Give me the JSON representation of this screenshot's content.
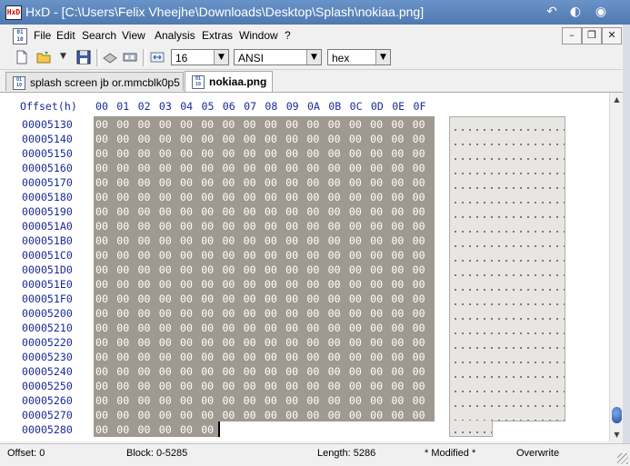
{
  "window": {
    "title": "HxD - [C:\\Users\\Felix Vheejhe\\Downloads\\Desktop\\Splash\\nokiaa.png]",
    "app_icon_text": "HxD"
  },
  "menu": [
    "File",
    "Edit",
    "Search",
    "View",
    "Analysis",
    "Extras",
    "Window",
    "?"
  ],
  "toolbar": {
    "bytes_per_row": "16",
    "charset": "ANSI",
    "offset_base": "hex"
  },
  "tabs": [
    {
      "label": "splash screen jb or.mmcblk0p5",
      "active": false
    },
    {
      "label": "nokiaa.png",
      "active": true
    }
  ],
  "hex_header": {
    "offset_label": "Offset(h)",
    "columns": [
      "00",
      "01",
      "02",
      "03",
      "04",
      "05",
      "06",
      "07",
      "08",
      "09",
      "0A",
      "0B",
      "0C",
      "0D",
      "0E",
      "0F"
    ]
  },
  "rows": [
    {
      "offset": "00005130",
      "bytes": "00 00 00 00 00 00 00 00 00 00 00 00 00 00 00 00"
    },
    {
      "offset": "00005140",
      "bytes": "00 00 00 00 00 00 00 00 00 00 00 00 00 00 00 00"
    },
    {
      "offset": "00005150",
      "bytes": "00 00 00 00 00 00 00 00 00 00 00 00 00 00 00 00"
    },
    {
      "offset": "00005160",
      "bytes": "00 00 00 00 00 00 00 00 00 00 00 00 00 00 00 00"
    },
    {
      "offset": "00005170",
      "bytes": "00 00 00 00 00 00 00 00 00 00 00 00 00 00 00 00"
    },
    {
      "offset": "00005180",
      "bytes": "00 00 00 00 00 00 00 00 00 00 00 00 00 00 00 00"
    },
    {
      "offset": "00005190",
      "bytes": "00 00 00 00 00 00 00 00 00 00 00 00 00 00 00 00"
    },
    {
      "offset": "000051A0",
      "bytes": "00 00 00 00 00 00 00 00 00 00 00 00 00 00 00 00"
    },
    {
      "offset": "000051B0",
      "bytes": "00 00 00 00 00 00 00 00 00 00 00 00 00 00 00 00"
    },
    {
      "offset": "000051C0",
      "bytes": "00 00 00 00 00 00 00 00 00 00 00 00 00 00 00 00"
    },
    {
      "offset": "000051D0",
      "bytes": "00 00 00 00 00 00 00 00 00 00 00 00 00 00 00 00"
    },
    {
      "offset": "000051E0",
      "bytes": "00 00 00 00 00 00 00 00 00 00 00 00 00 00 00 00"
    },
    {
      "offset": "000051F0",
      "bytes": "00 00 00 00 00 00 00 00 00 00 00 00 00 00 00 00"
    },
    {
      "offset": "00005200",
      "bytes": "00 00 00 00 00 00 00 00 00 00 00 00 00 00 00 00"
    },
    {
      "offset": "00005210",
      "bytes": "00 00 00 00 00 00 00 00 00 00 00 00 00 00 00 00"
    },
    {
      "offset": "00005220",
      "bytes": "00 00 00 00 00 00 00 00 00 00 00 00 00 00 00 00"
    },
    {
      "offset": "00005230",
      "bytes": "00 00 00 00 00 00 00 00 00 00 00 00 00 00 00 00"
    },
    {
      "offset": "00005240",
      "bytes": "00 00 00 00 00 00 00 00 00 00 00 00 00 00 00 00"
    },
    {
      "offset": "00005250",
      "bytes": "00 00 00 00 00 00 00 00 00 00 00 00 00 00 00 00"
    },
    {
      "offset": "00005260",
      "bytes": "00 00 00 00 00 00 00 00 00 00 00 00 00 00 00 00"
    },
    {
      "offset": "00005270",
      "bytes": "00 00 00 00 00 00 00 00 00 00 00 00 00 00 00 00"
    },
    {
      "offset": "00005280",
      "bytes": "00 00 00 00 00 00"
    }
  ],
  "status": {
    "offset": "Offset: 0",
    "block": "Block: 0-5285",
    "length": "Length: 5286",
    "modified": "* Modified *",
    "mode": "Overwrite"
  },
  "colors": {
    "titlebar": "#4f79b0",
    "selection": "#a09990",
    "hex_text": "#1a2a9a"
  },
  "icons": [
    "new-file-icon",
    "open-folder-icon",
    "save-icon",
    "disk-icon",
    "ram-icon",
    "columns-icon"
  ]
}
